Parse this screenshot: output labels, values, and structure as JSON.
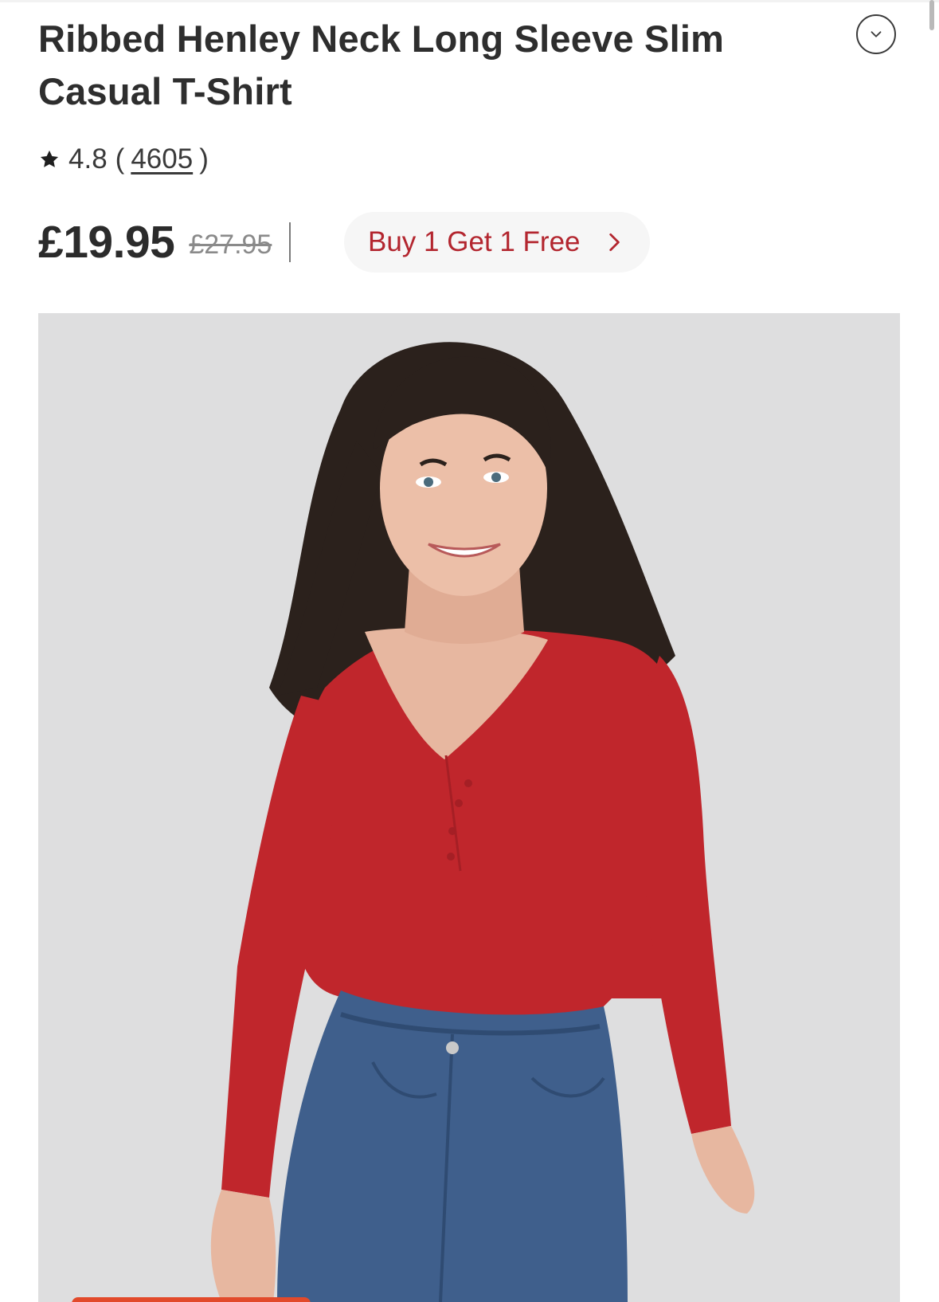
{
  "product": {
    "title": "Ribbed Henley Neck Long Sleeve Slim Casual T-Shirt",
    "rating": {
      "value": "4.8",
      "open_paren": "(",
      "count": "4605",
      "close_paren": ")",
      "icon": "star-icon"
    },
    "price": {
      "current": "£19.95",
      "original": "£27.95"
    },
    "promo": {
      "label": "Buy 1 Get 1 Free",
      "icon": "chevron-right-icon",
      "color": "#b3262f"
    },
    "collapse_icon": "chevron-down-icon",
    "image": {
      "description_icon": "product-photo",
      "garment_color": "#c0262c",
      "background_color": "#dededf"
    }
  }
}
